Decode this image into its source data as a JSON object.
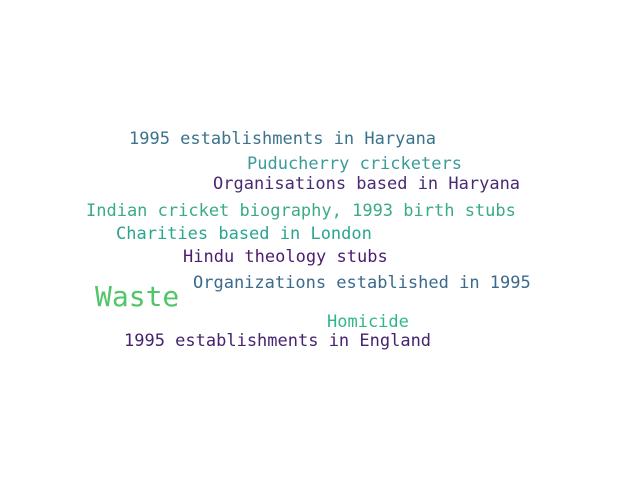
{
  "words": [
    {
      "text": "1995 establishments in Haryana",
      "color": "#3b728d"
    },
    {
      "text": "Puducherry cricketers",
      "color": "#3b9a9b"
    },
    {
      "text": "Organisations based in Haryana",
      "color": "#4a2b73"
    },
    {
      "text": "Indian cricket biography, 1993 birth stubs",
      "color": "#3aaa89"
    },
    {
      "text": "Charities based in London",
      "color": "#2aa58e"
    },
    {
      "text": "Hindu theology stubs",
      "color": "#4c1c6e"
    },
    {
      "text": "Waste",
      "color": "#52c56a"
    },
    {
      "text": "Organizations established in 1995",
      "color": "#3a6a8c"
    },
    {
      "text": "Homicide",
      "color": "#33b58b"
    },
    {
      "text": "1995 establishments in England",
      "color": "#46226f"
    }
  ]
}
